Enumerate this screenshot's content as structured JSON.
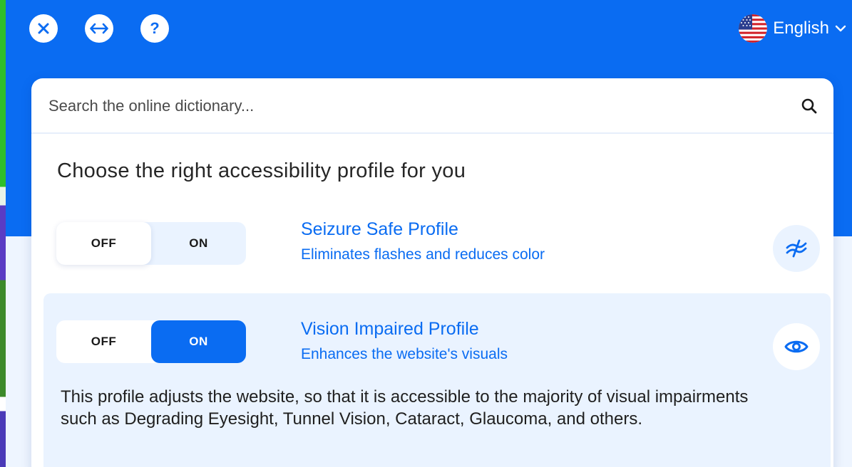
{
  "header": {
    "close_label": "Close",
    "resize_label": "Move",
    "help_glyph": "?",
    "language": {
      "label": "English",
      "flag": "us-flag"
    }
  },
  "search": {
    "placeholder": "Search the online dictionary..."
  },
  "heading": "Choose the right accessibility profile for you",
  "profiles": [
    {
      "title": "Seizure Safe Profile",
      "subtitle": "Eliminates flashes and reduces color",
      "toggle": {
        "off_label": "OFF",
        "on_label": "ON",
        "state": "off"
      },
      "icon": "lightning-waves-icon"
    },
    {
      "title": "Vision Impaired Profile",
      "subtitle": "Enhances the website's visuals",
      "toggle": {
        "off_label": "OFF",
        "on_label": "ON",
        "state": "on"
      },
      "icon": "eye-icon",
      "description": "This profile adjusts the website, so that it is accessible to the majority of visual impairments such as Degrading Eyesight, Tunnel Vision, Cataract, Glaucoma, and others."
    }
  ],
  "colors": {
    "primary": "#0a6cf2",
    "panel_light": "#eaf3ff",
    "text_dark": "#262626"
  }
}
